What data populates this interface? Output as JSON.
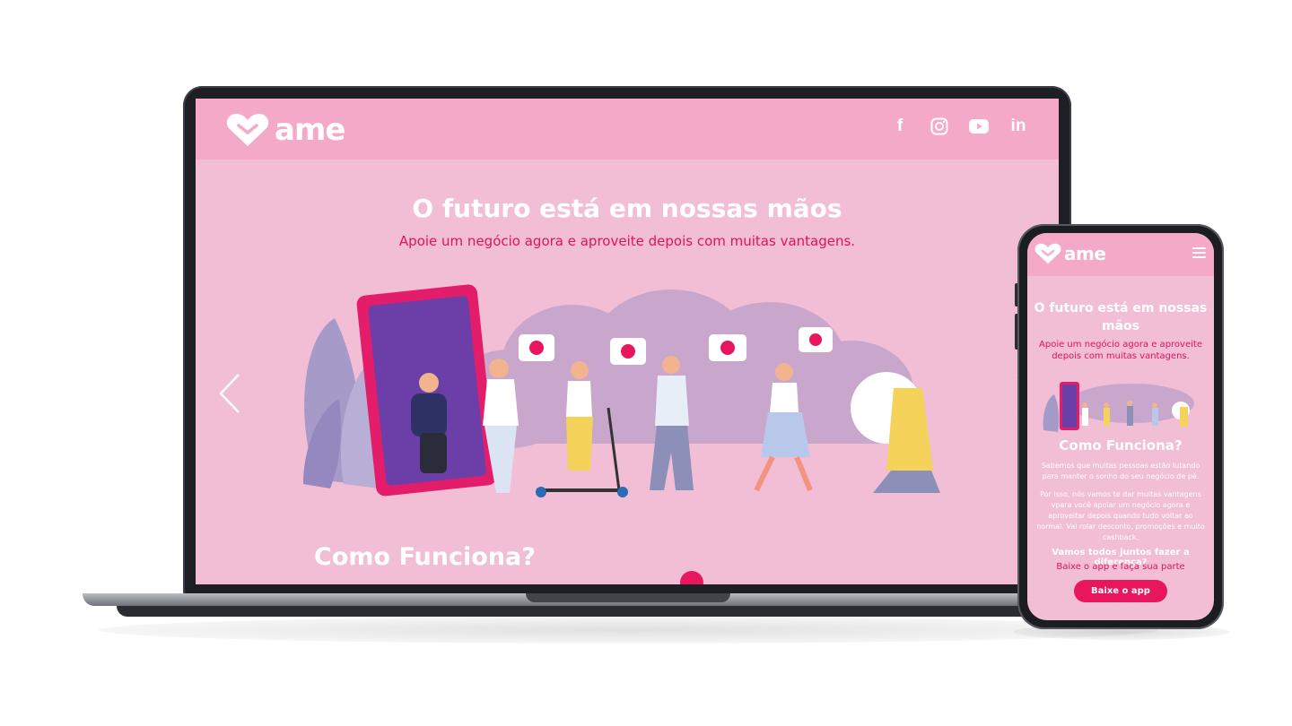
{
  "brand": {
    "logo_text": "ame",
    "accent": "#e8175d",
    "pink_bg": "#f2bed6",
    "header_bg": "#f5a9c8"
  },
  "laptop": {
    "social_icons": [
      {
        "icon": "facebook-icon",
        "glyph": "f"
      },
      {
        "icon": "instagram-icon",
        "glyph": ""
      },
      {
        "icon": "youtube-icon",
        "glyph": ""
      },
      {
        "icon": "linkedin-icon",
        "glyph": "in"
      }
    ],
    "hero": {
      "title": "O futuro está em nossas mãos",
      "subtitle": "Apoie um negócio agora e aproveite depois com muitas vantagens."
    },
    "section_title": "Como Funciona?"
  },
  "phone": {
    "hero": {
      "title": "O futuro está em nossas mãos",
      "subtitle": "Apoie um negócio agora e aproveite depois com muitas vantagens."
    },
    "section_title": "Como Funciona?",
    "body1": "Sabemos que muitas pessoas estão lutando para manter o sonho do seu negócio de pé.",
    "body2": "Por isso, nós vamos te dar muitas vantagens vpara você apoiar um negócio agora e aproveitar depois quando tudo voltar ao normal. Vai rolar desconto, promoções e muito cashback.",
    "question": "Vamos todos juntos fazer a diferença?",
    "cta_text": "Baixe o app e faça sua parte",
    "cta_button": "Baixe o app"
  }
}
